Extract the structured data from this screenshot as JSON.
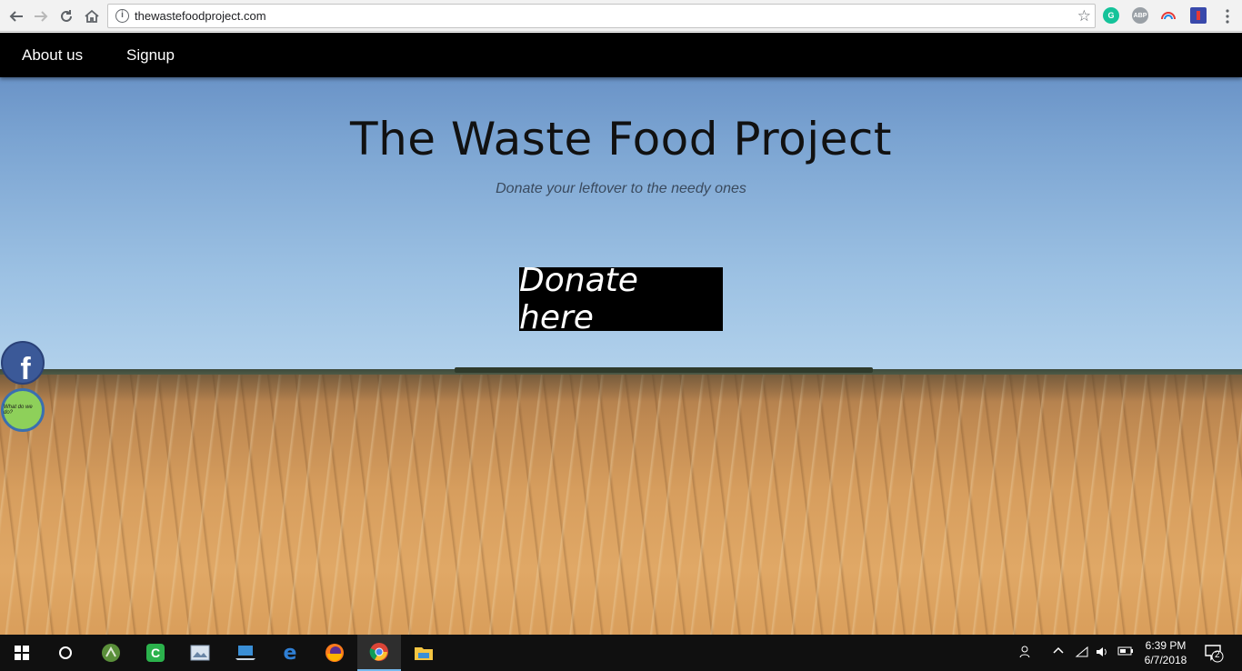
{
  "browser": {
    "url": "thewastefoodproject.com",
    "extensions": [
      "grammarly-icon",
      "adblock-plus-icon",
      "rainbow-extension-icon",
      "flag-extension-icon"
    ],
    "ext_labels": {
      "grammarly": "G",
      "abp": "ABP"
    }
  },
  "nav": {
    "about_label": "About us",
    "signup_label": "Signup"
  },
  "hero": {
    "title": "The Waste Food Project",
    "subtitle": "Donate your leftover to the needy ones",
    "donate_label": "Donate here"
  },
  "side_widgets": {
    "facebook_glyph": "f",
    "what_label": "What do we do?"
  },
  "taskbar": {
    "apps": [
      "windows-start-icon",
      "cortana-icon",
      "android-studio-icon",
      "camtasia-icon",
      "photo-viewer-icon",
      "laptop-icon",
      "edge-icon",
      "firefox-icon",
      "chrome-icon",
      "file-explorer-icon"
    ],
    "time": "6:39 PM",
    "date": "6/7/2018",
    "notification_count": "2"
  }
}
